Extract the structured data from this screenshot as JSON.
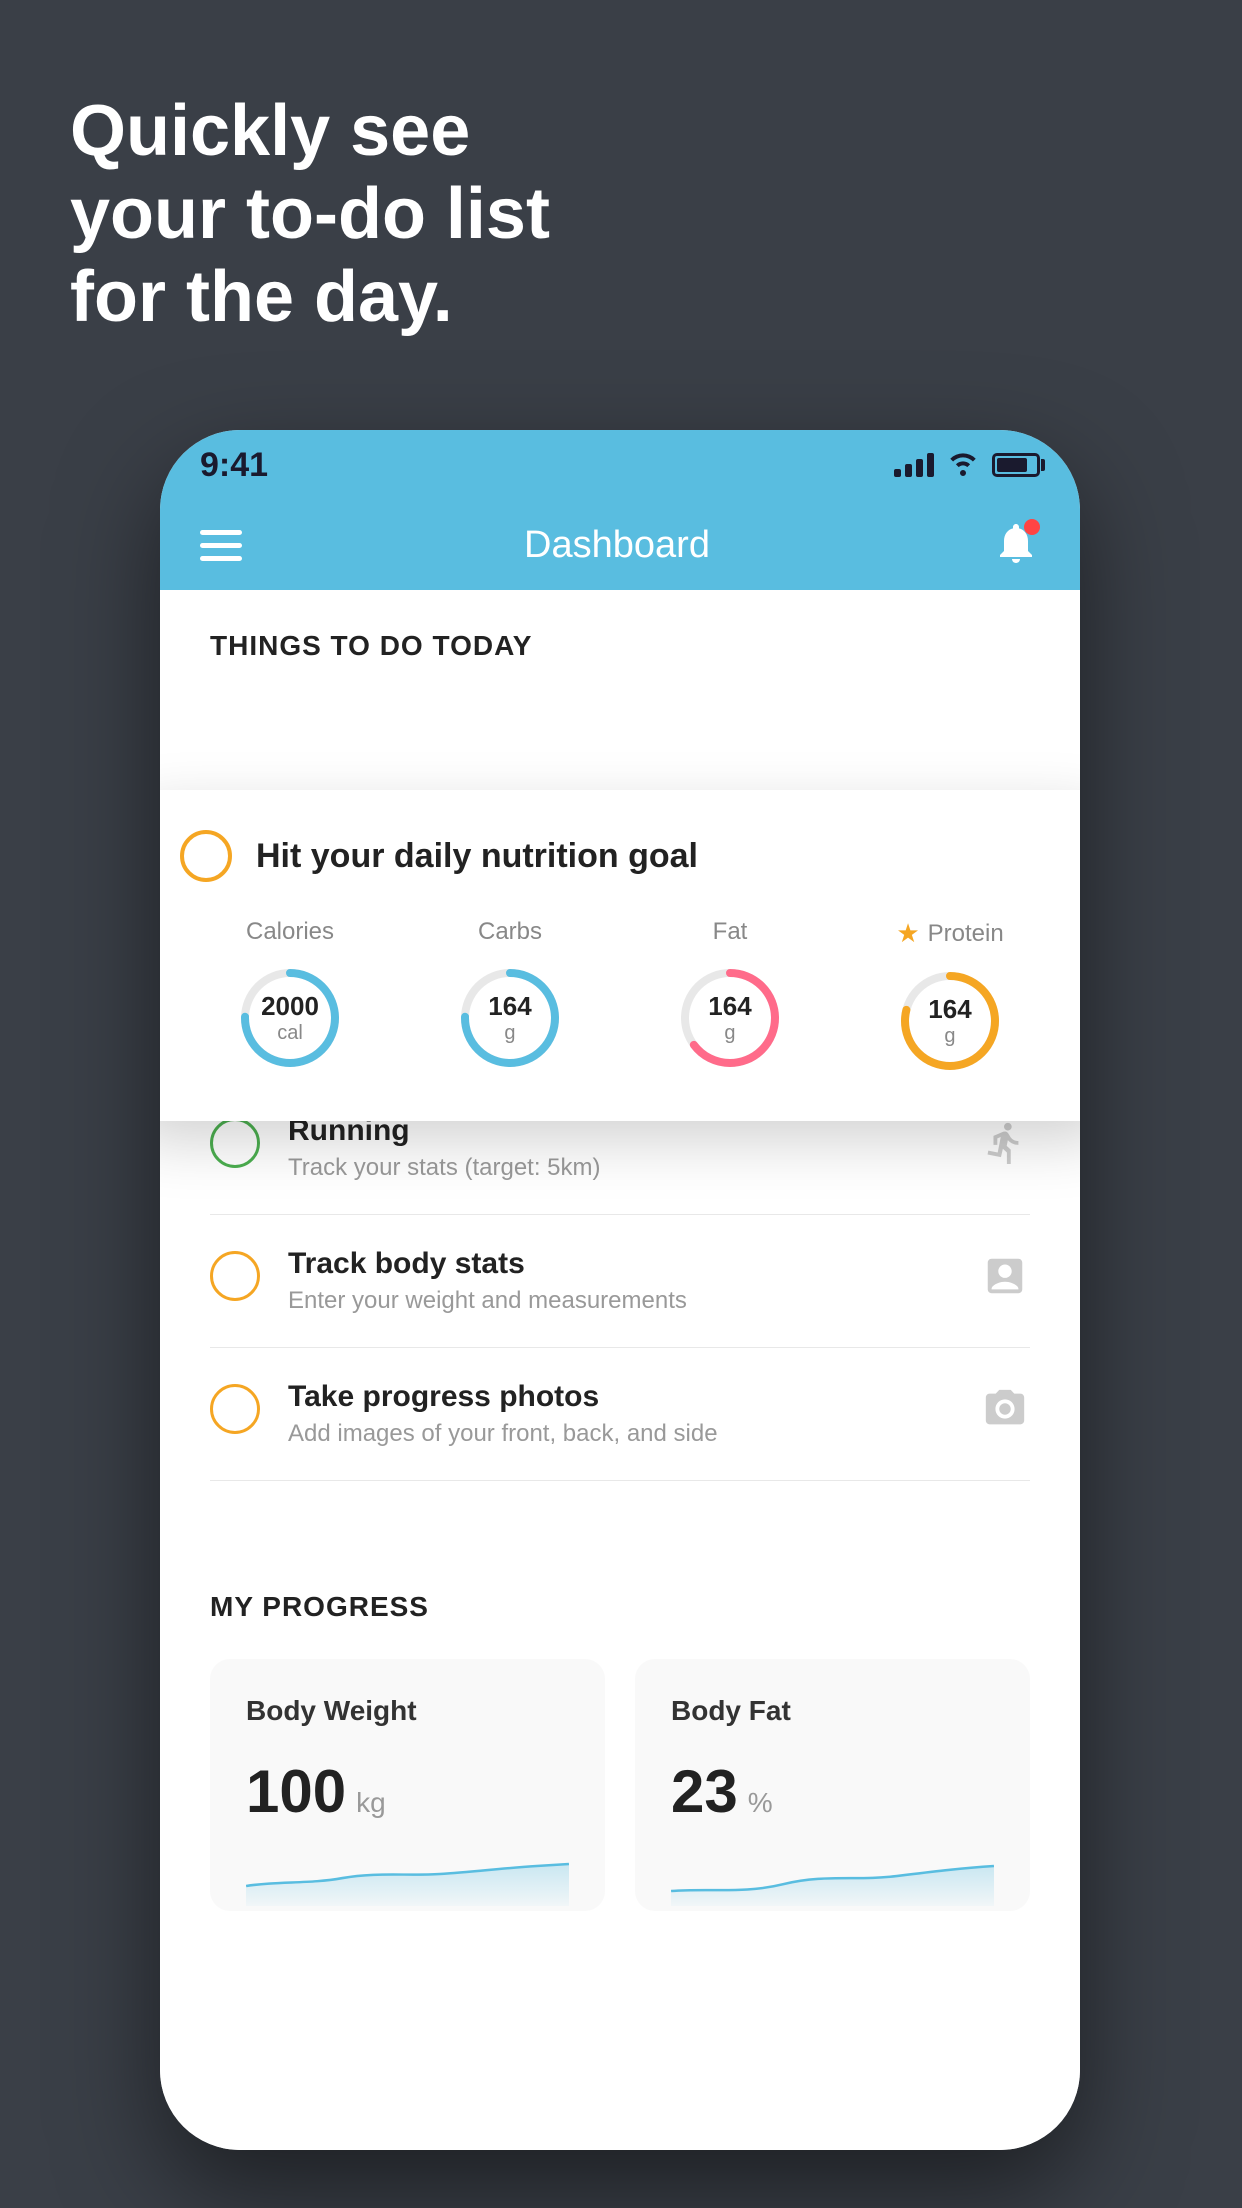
{
  "headline": {
    "line1": "Quickly see",
    "line2": "your to-do list",
    "line3": "for the day."
  },
  "status_bar": {
    "time": "9:41",
    "color": "#59bde0"
  },
  "header": {
    "title": "Dashboard"
  },
  "things_section": {
    "title": "THINGS TO DO TODAY"
  },
  "nutrition_card": {
    "title": "Hit your daily nutrition goal",
    "items": [
      {
        "label": "Calories",
        "value": "2000",
        "unit": "cal",
        "color": "blue"
      },
      {
        "label": "Carbs",
        "value": "164",
        "unit": "g",
        "color": "blue"
      },
      {
        "label": "Fat",
        "value": "164",
        "unit": "g",
        "color": "pink"
      },
      {
        "label": "Protein",
        "value": "164",
        "unit": "g",
        "color": "yellow",
        "star": true
      }
    ]
  },
  "todo_items": [
    {
      "title": "Running",
      "subtitle": "Track your stats (target: 5km)",
      "circle_color": "green",
      "icon": "shoe"
    },
    {
      "title": "Track body stats",
      "subtitle": "Enter your weight and measurements",
      "circle_color": "yellow",
      "icon": "scale"
    },
    {
      "title": "Take progress photos",
      "subtitle": "Add images of your front, back, and side",
      "circle_color": "yellow",
      "icon": "person"
    }
  ],
  "progress_section": {
    "title": "MY PROGRESS",
    "cards": [
      {
        "title": "Body Weight",
        "value": "100",
        "unit": "kg"
      },
      {
        "title": "Body Fat",
        "value": "23",
        "unit": "%"
      }
    ]
  }
}
